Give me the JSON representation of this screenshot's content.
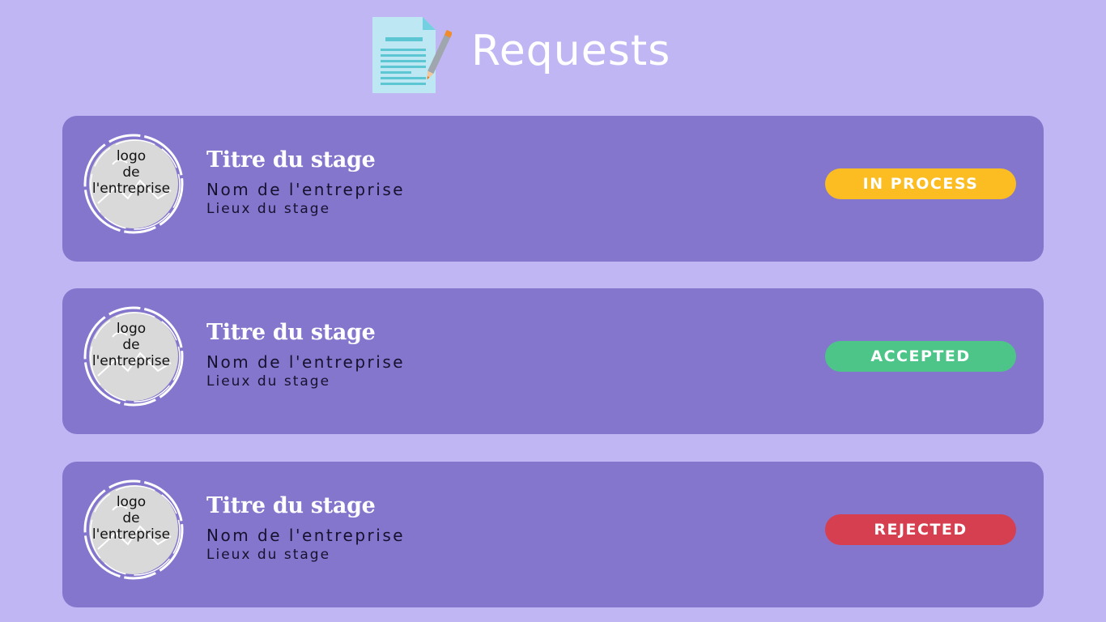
{
  "page": {
    "title": "Requests"
  },
  "header": {
    "icon": "document-pencil-icon"
  },
  "requests": [
    {
      "logo_text": "logo\nde\nl'entreprise",
      "stage_title": "Titre du stage",
      "company": "Nom de l'entreprise",
      "location": "Lieux du stage",
      "status": "IN PROCESS",
      "status_color": "#fbbd22"
    },
    {
      "logo_text": "logo\nde\nl'entreprise",
      "stage_title": "Titre du stage",
      "company": "Nom de l'entreprise",
      "location": "Lieux du stage",
      "status": "ACCEPTED",
      "status_color": "#4dc589"
    },
    {
      "logo_text": "logo\nde\nl'entreprise",
      "stage_title": "Titre du stage",
      "company": "Nom de l'entreprise",
      "location": "Lieux du stage",
      "status": "REJECTED",
      "status_color": "#d63f50"
    }
  ],
  "colors": {
    "background": "#c0b6f3",
    "card": "#8476cd",
    "logo_fill": "#d9d9d9"
  }
}
